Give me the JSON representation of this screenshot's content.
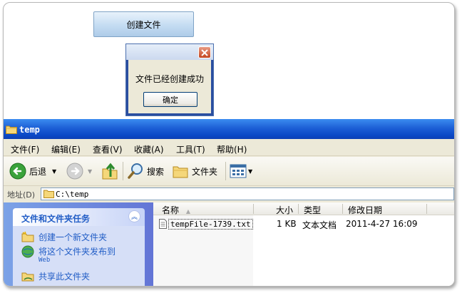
{
  "app": {
    "create_button_label": "创建文件"
  },
  "dialog": {
    "message": "文件已经创建成功",
    "ok_label": "确定"
  },
  "window": {
    "title": "temp",
    "menu": [
      "文件(F)",
      "编辑(E)",
      "查看(V)",
      "收藏(A)",
      "工具(T)",
      "帮助(H)"
    ],
    "toolbar": {
      "back_label": "后退",
      "search_label": "搜索",
      "folders_label": "文件夹"
    },
    "address": {
      "label": "地址(D)",
      "value": "C:\\temp"
    }
  },
  "task_pane": {
    "header": "文件和文件夹任务",
    "items": [
      {
        "label": "创建一个新文件夹",
        "icon": "new-folder-icon"
      },
      {
        "label": "将这个文件夹发布到",
        "sub": "Web",
        "icon": "publish-web-icon"
      },
      {
        "label": "共享此文件夹",
        "icon": "share-folder-icon"
      }
    ]
  },
  "file_list": {
    "columns": [
      "名称",
      "大小",
      "类型",
      "修改日期"
    ],
    "rows": [
      {
        "name": "tempFile-1739.txt",
        "size": "1 KB",
        "type": "文本文档",
        "modified": "2011-4-27 16:09"
      }
    ]
  },
  "colors": {
    "titlebar": "#0a49c7",
    "taskpane": "#6375d6",
    "task_link": "#215dc6"
  }
}
